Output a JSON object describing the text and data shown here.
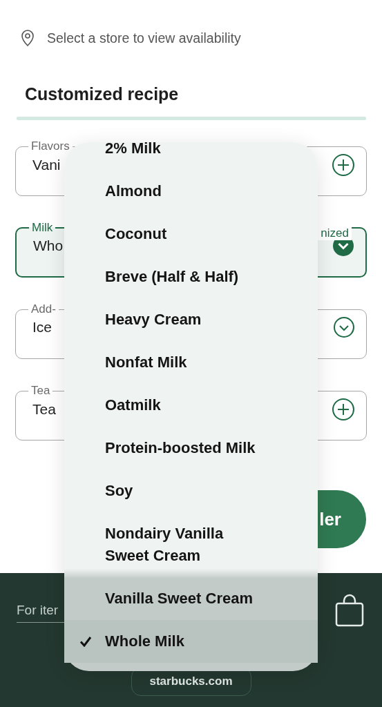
{
  "location": {
    "text": "Select a store to view availability"
  },
  "section_title": "Customized recipe",
  "fields": [
    {
      "kind": "add",
      "label": "Flavors",
      "value": "Vani",
      "focused": false
    },
    {
      "kind": "select",
      "label": "Milk",
      "label_end": "nized",
      "value": "Who",
      "focused": true
    },
    {
      "kind": "select",
      "label": "Add-",
      "value": "Ice",
      "focused": false
    },
    {
      "kind": "add",
      "label": "Tea",
      "value": "Tea",
      "focused": false
    }
  ],
  "order_button": {
    "label": "ler"
  },
  "footer": {
    "item_field": {
      "placeholder": "For iter"
    },
    "link": "starbucks.com"
  },
  "milk_menu": {
    "items": [
      {
        "label": "2% Milk",
        "selected": false
      },
      {
        "label": "Almond",
        "selected": false
      },
      {
        "label": "Coconut",
        "selected": false
      },
      {
        "label": "Breve (Half & Half)",
        "selected": false
      },
      {
        "label": "Heavy Cream",
        "selected": false
      },
      {
        "label": "Nonfat Milk",
        "selected": false
      },
      {
        "label": "Oatmilk",
        "selected": false
      },
      {
        "label": "Protein-boosted Milk",
        "selected": false
      },
      {
        "label": "Soy",
        "selected": false
      },
      {
        "label": "Nondairy Vanilla\nSweet Cream",
        "selected": false
      },
      {
        "label": "Vanilla Sweet Cream",
        "selected": false
      },
      {
        "label": "Whole Milk",
        "selected": true
      }
    ]
  }
}
